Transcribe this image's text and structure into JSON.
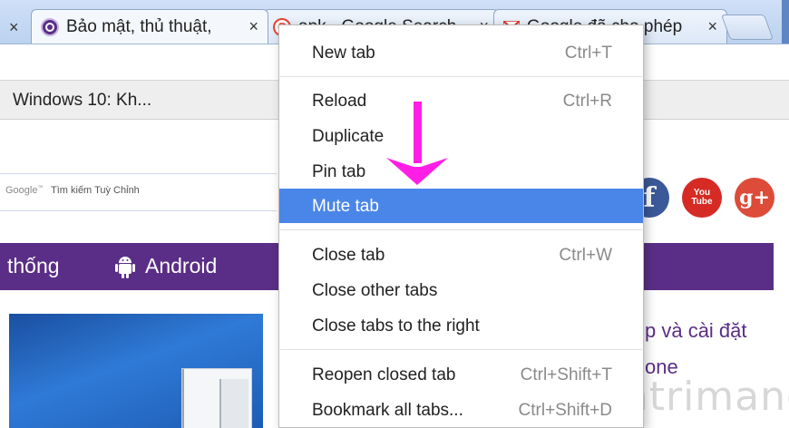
{
  "tabs": [
    {
      "title": "",
      "close": "×"
    },
    {
      "title": "Bảo mật, thủ thuật,",
      "close": "×",
      "favicon": "quantrimang-icon",
      "active": true
    },
    {
      "title": "apk - Google Search",
      "close": "×",
      "favicon": "google-icon"
    },
    {
      "title": "Google đã cho phép",
      "close": "×",
      "favicon": "gmail-icon"
    }
  ],
  "bookmark_bar": {
    "item": "Windows 10: Kh..."
  },
  "search": {
    "brand": "Google",
    "brand_tm": "™",
    "label": "Tìm kiếm Tuỳ Chỉnh"
  },
  "social": {
    "facebook": "f",
    "youtube_top": "You",
    "youtube_bottom": "Tube",
    "gplus": "g+"
  },
  "nav": {
    "system": "thống",
    "android": "Android"
  },
  "article": {
    "line1": "p và cài đặt",
    "line2": "one"
  },
  "watermark": {
    "text": "uantrimang"
  },
  "context_menu": {
    "items": [
      {
        "label": "New tab",
        "shortcut": "Ctrl+T"
      },
      {
        "label": "Reload",
        "shortcut": "Ctrl+R"
      },
      {
        "label": "Duplicate",
        "shortcut": ""
      },
      {
        "label": "Pin tab",
        "shortcut": ""
      },
      {
        "label": "Mute tab",
        "shortcut": ""
      },
      {
        "label": "Close tab",
        "shortcut": "Ctrl+W"
      },
      {
        "label": "Close other tabs",
        "shortcut": ""
      },
      {
        "label": "Close tabs to the right",
        "shortcut": ""
      },
      {
        "label": "Reopen closed tab",
        "shortcut": "Ctrl+Shift+T"
      },
      {
        "label": "Bookmark all tabs...",
        "shortcut": "Ctrl+Shift+D"
      }
    ],
    "highlighted": "Mute tab"
  },
  "colors": {
    "menu_highlight": "#4a86e8",
    "nav_purple": "#5a2e86",
    "arrow_magenta": "#ff1ee6"
  }
}
